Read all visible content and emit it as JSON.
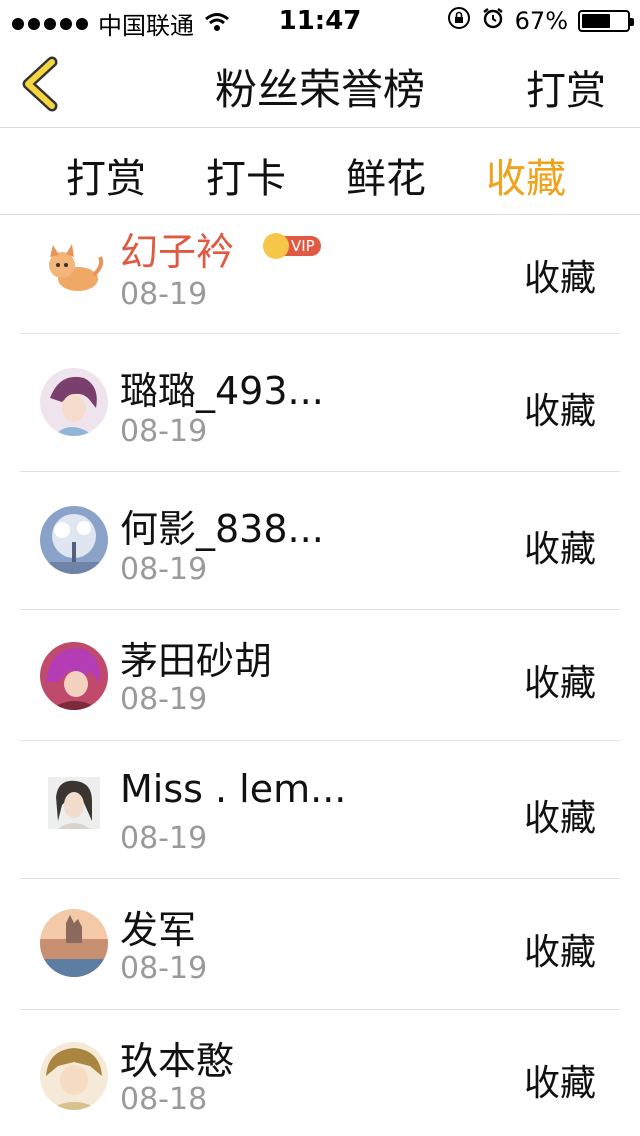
{
  "status_bar": {
    "carrier": "中国联通",
    "time": "11:47",
    "battery_percent_label": "67%",
    "battery_level": 0.67
  },
  "nav": {
    "title": "粉丝荣誉榜",
    "right_action": "打赏"
  },
  "tabs": [
    {
      "label": "打赏",
      "active": false
    },
    {
      "label": "打卡",
      "active": false
    },
    {
      "label": "鲜花",
      "active": false
    },
    {
      "label": "收藏",
      "active": true
    }
  ],
  "colors": {
    "accent": "#f0a21c",
    "vip_name": "#e05a43",
    "date": "#9a9a9a",
    "separator": "#e2e2e2"
  },
  "list": [
    {
      "name": "幻子衿",
      "date": "08-19",
      "action": "收藏",
      "vip": true,
      "vip_label": "VIP"
    },
    {
      "name": "璐璐_493...",
      "date": "08-19",
      "action": "收藏"
    },
    {
      "name": "何影_838...",
      "date": "08-19",
      "action": "收藏"
    },
    {
      "name": "茅田砂胡",
      "date": "08-19",
      "action": "收藏"
    },
    {
      "name": "Miss . lem...",
      "date": "08-19",
      "action": "收藏"
    },
    {
      "name": "发军",
      "date": "08-19",
      "action": "收藏"
    },
    {
      "name": "玖本憨",
      "date": "08-18",
      "action": "收藏"
    }
  ]
}
